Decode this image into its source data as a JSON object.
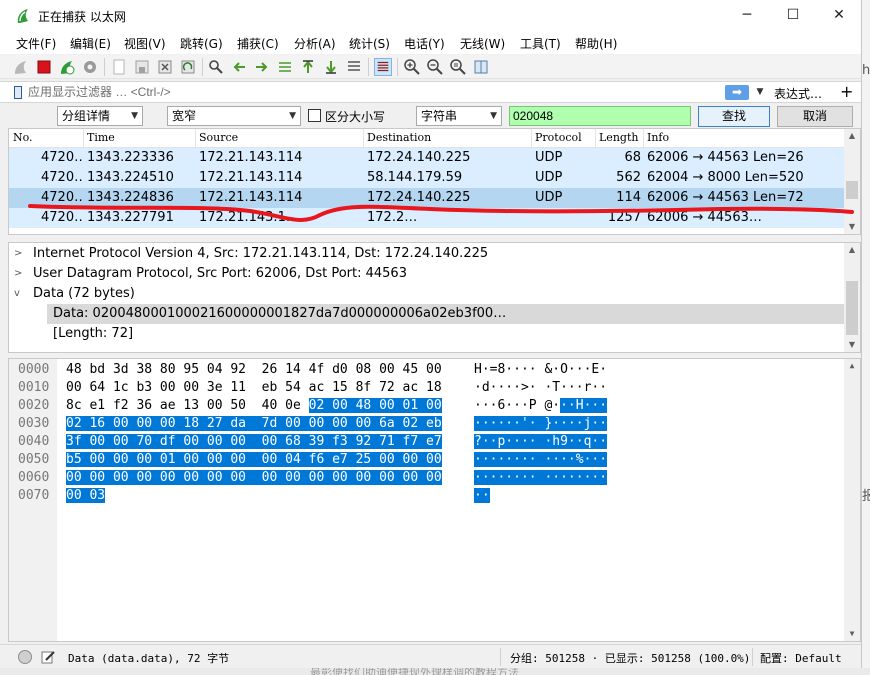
{
  "window": {
    "title": "正在捕获 以太网",
    "controls": {
      "minimize": "─",
      "maximize": "☐",
      "close": "✕"
    }
  },
  "menu": [
    "文件(F)",
    "编辑(E)",
    "视图(V)",
    "跳转(G)",
    "捕获(C)",
    "分析(A)",
    "统计(S)",
    "电话(Y)",
    "无线(W)",
    "工具(T)",
    "帮助(H)"
  ],
  "filter": {
    "placeholder": "应用显示过滤器 … <Ctrl-/>",
    "expression_label": "表达式…",
    "plus": "+",
    "apply_icon": "➡",
    "dropdown_icon": "▼"
  },
  "find": {
    "search_in": "分组详情",
    "char_width": "宽窄",
    "case_sensitive_label": "区分大小写",
    "search_type": "字符串",
    "search_value": "020048",
    "find_label": "查找",
    "cancel_label": "取消"
  },
  "packet_list": {
    "columns": [
      "No.",
      "Time",
      "Source",
      "Destination",
      "Protocol",
      "Length",
      "Info"
    ],
    "rows": [
      {
        "no": "4720…",
        "time": "1343.223336",
        "source": "172.21.143.114",
        "destination": "172.24.140.225",
        "protocol": "UDP",
        "length": "68",
        "info": "62006 → 44563 Len=26"
      },
      {
        "no": "4720…",
        "time": "1343.224510",
        "source": "172.21.143.114",
        "destination": "58.144.179.59",
        "protocol": "UDP",
        "length": "562",
        "info": "62004 → 8000 Len=520"
      },
      {
        "no": "4720…",
        "time": "1343.224836",
        "source": "172.21.143.114",
        "destination": "172.24.140.225",
        "protocol": "UDP",
        "length": "114",
        "info": "62006 → 44563 Len=72"
      },
      {
        "no": "4720…",
        "time": "1343.227791",
        "source": "172.21.143.1…",
        "destination": "172.2…",
        "protocol": "",
        "length": "1257",
        "info": "62006 → 44563…"
      }
    ]
  },
  "details": {
    "rows": [
      {
        "toggle": ">",
        "text": "Internet Protocol Version 4, Src: 172.21.143.114, Dst: 172.24.140.225"
      },
      {
        "toggle": ">",
        "text": "User Datagram Protocol, Src Port: 62006, Dst Port: 44563"
      },
      {
        "toggle": "v",
        "text": "Data (72 bytes)"
      },
      {
        "toggle": "",
        "text": "Data: 020048000100021600000001827da7d000000006a02eb3f00…"
      },
      {
        "toggle": "",
        "text": "[Length: 72]"
      }
    ]
  },
  "bytes": {
    "rows": [
      {
        "offset": "0000",
        "hex": [
          "48 bd 3d 38 80 95 04 92  26 14 4f d0 08 00 45 00",
          ""
        ],
        "ascii": [
          "H·=8···· &·O···E·",
          ""
        ]
      },
      {
        "offset": "0010",
        "hex": [
          "00 64 1c b3 00 00 3e 11  eb 54 ac 15 8f 72 ac 18",
          ""
        ],
        "ascii": [
          "·d····>· ·T···r··",
          ""
        ]
      },
      {
        "offset": "0020",
        "hex": [
          "8c e1 f2 36 ae 13 00 50  40 0e ",
          "02 00 48 00 01 00"
        ],
        "ascii": [
          "···6···P @·",
          "··H···"
        ]
      },
      {
        "offset": "0030",
        "hex": [
          "",
          "02 16 00 00 00 18 27 da  7d 00 00 00 00 6a 02 eb"
        ],
        "ascii": [
          "",
          "······'· }····j··"
        ]
      },
      {
        "offset": "0040",
        "hex": [
          "",
          "3f 00 00 70 df 00 00 00  00 68 39 f3 92 71 f7 e7"
        ],
        "ascii": [
          "",
          "?··p···· ·h9··q··"
        ]
      },
      {
        "offset": "0050",
        "hex": [
          "",
          "b5 00 00 00 01 00 00 00  00 04 f6 e7 25 00 00 00"
        ],
        "ascii": [
          "",
          "········ ····%···"
        ]
      },
      {
        "offset": "0060",
        "hex": [
          "",
          "00 00 00 00 00 00 00 00  00 00 00 00 00 00 00 00"
        ],
        "ascii": [
          "",
          "········ ········"
        ]
      },
      {
        "offset": "0070",
        "hex": [
          "",
          "00 03"
        ],
        "ascii": [
          "",
          "··"
        ]
      }
    ]
  },
  "status": {
    "field": "Data (data.data), 72 字节",
    "packets": "分组: 501258 · 已显示: 501258 (100.0%)",
    "profile": "配置: Default"
  },
  "background": {
    "bottom_text": "最彰便找们助迪便捷现外理样调的教程方法",
    "right_text": "h",
    "right_char": "报"
  },
  "colors": {
    "accent": "#0078d7",
    "row_bg": "#daeeff",
    "selected_row_bg": "#b4d6f0",
    "find_bg": "#afffaf",
    "annotation_line": "#e8171e"
  }
}
